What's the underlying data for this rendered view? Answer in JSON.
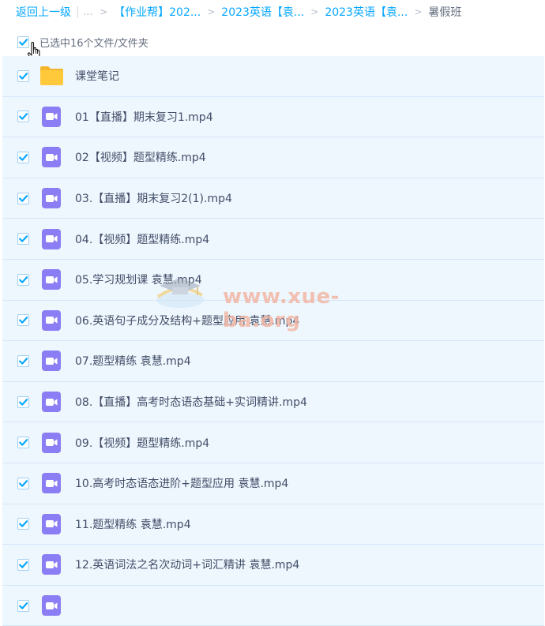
{
  "breadcrumb": {
    "back": "返回上一级",
    "ellipsis": "...",
    "items": [
      "【作业帮】202...",
      "2023英语【袁...",
      "2023英语【袁..."
    ],
    "current": "暑假班"
  },
  "selection": {
    "text": "已选中16个文件/文件夹"
  },
  "files": [
    {
      "name": "课堂笔记",
      "type": "folder"
    },
    {
      "name": "01【直播】期末复习1.mp4",
      "type": "video"
    },
    {
      "name": "02【视频】题型精练.mp4",
      "type": "video"
    },
    {
      "name": "03.【直播】期末复习2(1).mp4",
      "type": "video"
    },
    {
      "name": "04.【视频】题型精练.mp4",
      "type": "video"
    },
    {
      "name": "05.学习规划课 袁慧.mp4",
      "type": "video"
    },
    {
      "name": "06.英语句子成分及结构+题型应用 袁慧.mp4",
      "type": "video"
    },
    {
      "name": "07.题型精练 袁慧.mp4",
      "type": "video"
    },
    {
      "name": "08.【直播】高考时态语态基础+实词精讲.mp4",
      "type": "video"
    },
    {
      "name": "09.【视频】题型精练.mp4",
      "type": "video"
    },
    {
      "name": "10.高考时态语态进阶+题型应用 袁慧.mp4",
      "type": "video"
    },
    {
      "name": "11.题型精练 袁慧.mp4",
      "type": "video"
    },
    {
      "name": "12.英语词法之名次动词+词汇精讲 袁慧.mp4",
      "type": "video"
    },
    {
      "name": "",
      "type": "video"
    }
  ],
  "watermark": {
    "text": "www.xue-ba.org"
  },
  "colors": {
    "accent": "#06a7ff",
    "selected_row": "#eef6fe",
    "video_icon": "#8b7df4",
    "folder_icon": "#ffc93b",
    "checkmark": "#06a7ff"
  }
}
